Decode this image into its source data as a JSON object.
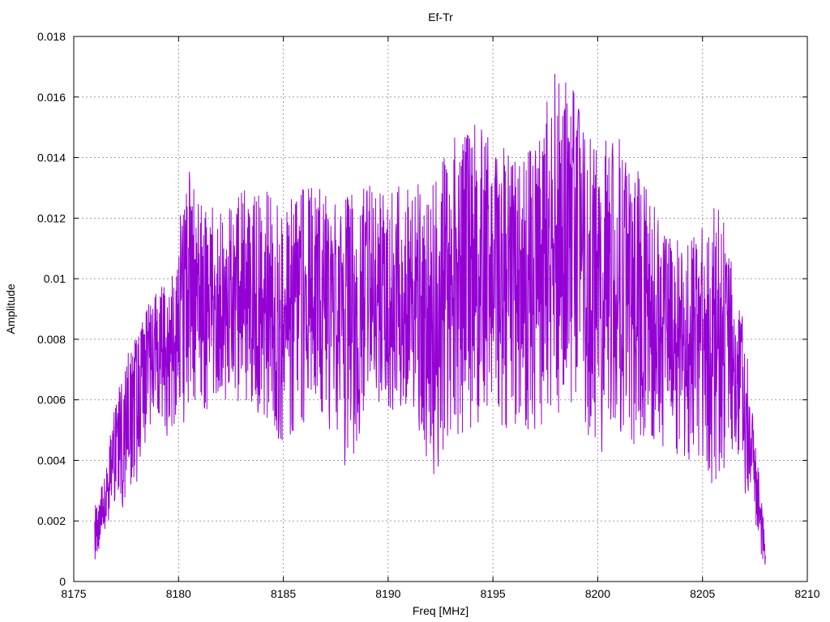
{
  "chart_data": {
    "type": "line",
    "title": "Ef-Tr",
    "xlabel": "Freq [MHz]",
    "ylabel": "Amplitude",
    "xlim": [
      8175,
      8210
    ],
    "ylim": [
      0,
      0.018
    ],
    "xticks": [
      8175,
      8180,
      8185,
      8190,
      8195,
      8200,
      8205,
      8210
    ],
    "xtick_labels": [
      "8175",
      "8180",
      "8185",
      "8190",
      "8195",
      "8200",
      "8205",
      "8210"
    ],
    "yticks": [
      0,
      0.002,
      0.004,
      0.006,
      0.008,
      0.01,
      0.012,
      0.014,
      0.016,
      0.018
    ],
    "ytick_labels": [
      "0",
      "0.002",
      "0.004",
      "0.006",
      "0.008",
      "0.01",
      "0.012",
      "0.014",
      "0.016",
      "0.018"
    ],
    "grid": true,
    "legend": "none",
    "series": [
      {
        "color": "#9400d3",
        "x_start": 8176,
        "x_end": 8208,
        "envelope": [
          {
            "x": 8176.0,
            "min": 0.0007,
            "max": 0.0027,
            "mean": 0.0015
          },
          {
            "x": 8176.5,
            "min": 0.0015,
            "max": 0.0035,
            "mean": 0.0025
          },
          {
            "x": 8177.0,
            "min": 0.0028,
            "max": 0.0062,
            "mean": 0.0045
          },
          {
            "x": 8177.5,
            "min": 0.0018,
            "max": 0.0075,
            "mean": 0.0055
          },
          {
            "x": 8178.0,
            "min": 0.0028,
            "max": 0.0082,
            "mean": 0.0065
          },
          {
            "x": 8178.5,
            "min": 0.005,
            "max": 0.009,
            "mean": 0.0075
          },
          {
            "x": 8179.0,
            "min": 0.0055,
            "max": 0.0102,
            "mean": 0.0078
          },
          {
            "x": 8179.5,
            "min": 0.0047,
            "max": 0.0095,
            "mean": 0.0075
          },
          {
            "x": 8180.0,
            "min": 0.0045,
            "max": 0.0124,
            "mean": 0.008
          },
          {
            "x": 8180.5,
            "min": 0.006,
            "max": 0.0136,
            "mean": 0.0095
          },
          {
            "x": 8181.0,
            "min": 0.0055,
            "max": 0.0125,
            "mean": 0.009
          },
          {
            "x": 8182.0,
            "min": 0.006,
            "max": 0.0125,
            "mean": 0.0092
          },
          {
            "x": 8183.0,
            "min": 0.0058,
            "max": 0.013,
            "mean": 0.0093
          },
          {
            "x": 8184.0,
            "min": 0.0055,
            "max": 0.0132,
            "mean": 0.0093
          },
          {
            "x": 8185.0,
            "min": 0.0042,
            "max": 0.0128,
            "mean": 0.009
          },
          {
            "x": 8186.0,
            "min": 0.0052,
            "max": 0.013,
            "mean": 0.009
          },
          {
            "x": 8187.0,
            "min": 0.0055,
            "max": 0.013,
            "mean": 0.009
          },
          {
            "x": 8188.0,
            "min": 0.003,
            "max": 0.0127,
            "mean": 0.0088
          },
          {
            "x": 8189.0,
            "min": 0.006,
            "max": 0.0133,
            "mean": 0.0093
          },
          {
            "x": 8190.0,
            "min": 0.0055,
            "max": 0.0128,
            "mean": 0.009
          },
          {
            "x": 8191.0,
            "min": 0.0055,
            "max": 0.0133,
            "mean": 0.0093
          },
          {
            "x": 8192.0,
            "min": 0.0033,
            "max": 0.013,
            "mean": 0.009
          },
          {
            "x": 8193.0,
            "min": 0.0045,
            "max": 0.0147,
            "mean": 0.0095
          },
          {
            "x": 8194.0,
            "min": 0.005,
            "max": 0.0152,
            "mean": 0.0095
          },
          {
            "x": 8195.0,
            "min": 0.0055,
            "max": 0.0148,
            "mean": 0.0095
          },
          {
            "x": 8196.0,
            "min": 0.0045,
            "max": 0.014,
            "mean": 0.0095
          },
          {
            "x": 8197.0,
            "min": 0.005,
            "max": 0.0145,
            "mean": 0.0097
          },
          {
            "x": 8198.0,
            "min": 0.0052,
            "max": 0.0172,
            "mean": 0.0105
          },
          {
            "x": 8199.0,
            "min": 0.006,
            "max": 0.0163,
            "mean": 0.0105
          },
          {
            "x": 8200.0,
            "min": 0.0038,
            "max": 0.0145,
            "mean": 0.0095
          },
          {
            "x": 8201.0,
            "min": 0.005,
            "max": 0.015,
            "mean": 0.0097
          },
          {
            "x": 8202.0,
            "min": 0.0042,
            "max": 0.0135,
            "mean": 0.009
          },
          {
            "x": 8203.0,
            "min": 0.0045,
            "max": 0.012,
            "mean": 0.0085
          },
          {
            "x": 8204.0,
            "min": 0.004,
            "max": 0.0112,
            "mean": 0.008
          },
          {
            "x": 8205.0,
            "min": 0.003,
            "max": 0.0122,
            "mean": 0.008
          },
          {
            "x": 8206.0,
            "min": 0.0035,
            "max": 0.0125,
            "mean": 0.0078
          },
          {
            "x": 8206.5,
            "min": 0.0045,
            "max": 0.01,
            "mean": 0.0072
          },
          {
            "x": 8207.0,
            "min": 0.0028,
            "max": 0.0085,
            "mean": 0.006
          },
          {
            "x": 8207.5,
            "min": 0.002,
            "max": 0.0048,
            "mean": 0.0035
          },
          {
            "x": 8208.0,
            "min": 0.0,
            "max": 0.0015,
            "mean": 0.0008
          }
        ]
      }
    ]
  }
}
